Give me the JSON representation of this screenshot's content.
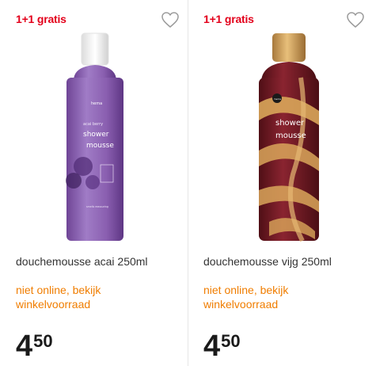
{
  "products": [
    {
      "badge": "1+1 gratis",
      "name": "douchemousse acai 250ml",
      "availability": "niet online, bekijk winkelvoorraad",
      "price_euros": "4",
      "price_cents": "50",
      "label_brand": "hema",
      "label_flavor": "acai berry",
      "label_line1": "shower",
      "label_line2": "mousse",
      "label_small": "smells reassuring",
      "can_color": "#8a5fb0",
      "cap_color": "#f7f7f7"
    },
    {
      "badge": "1+1 gratis",
      "name": "douchemousse vijg 250ml",
      "availability": "niet online, bekijk winkelvoorraad",
      "price_euros": "4",
      "price_cents": "50",
      "label_brand": "hema",
      "label_line1": "shower",
      "label_line2": "mousse",
      "can_color": "#6e1a22",
      "accent_color": "#d9a65a"
    }
  ],
  "colors": {
    "badge": "#e3001b",
    "availability": "#f07d00",
    "price": "#1a1a1a"
  },
  "icons": {
    "favorite": "heart-outline-icon"
  }
}
